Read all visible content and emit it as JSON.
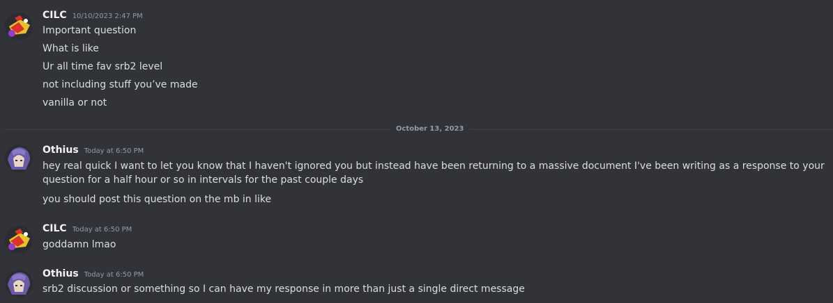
{
  "messages": [
    {
      "author": "CILC",
      "timestamp": "10/10/2023 2:47 PM",
      "lines": [
        "Important question",
        "What is like",
        "Ur all time fav srb2 level",
        "not including stuff you’ve made",
        "vanilla or not"
      ]
    },
    {
      "author": "Othius",
      "timestamp": "Today at 6:50 PM",
      "lines": [
        "hey real quick I want to let you know that I haven't ignored you but instead have been returning to a massive document I've been writing as a response to your question for a half hour or so in intervals for the past couple days",
        "you should post this question on the mb in like"
      ]
    },
    {
      "author": "CILC",
      "timestamp": "Today at 6:50 PM",
      "lines": [
        "goddamn lmao"
      ]
    },
    {
      "author": "Othius",
      "timestamp": "Today at 6:50 PM",
      "lines": [
        "srb2 discussion or something so I can have my response in more than just a single direct message"
      ]
    }
  ],
  "date_divider": "October 13, 2023",
  "colors": {
    "background": "#313338",
    "username": "#f2f3f5",
    "text": "#dbdee1",
    "muted": "#949ba4"
  },
  "icons": {
    "cilc_avatar": "red-yellow-character-avatar",
    "othius_avatar": "purple-hair-character-avatar"
  }
}
